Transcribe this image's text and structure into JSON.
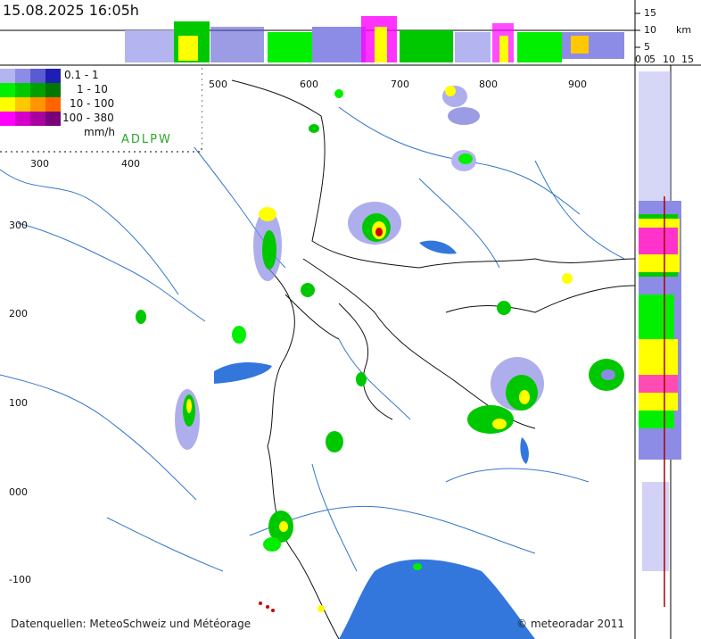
{
  "timestamp": "15.08.2025 16:05h",
  "sources": "Datenquellen: MeteoSchweiz und Météorage",
  "copyright": "© meteoradar 2011",
  "abbrev": "ADLPW",
  "legend": {
    "unit": "mm/h",
    "rows": [
      {
        "label": "0.1 -    1",
        "colors": [
          "#b4b4f0",
          "#8c8ce6",
          "#5a5ad2",
          "#1e1eb4"
        ]
      },
      {
        "label": "1 -   10",
        "colors": [
          "#00f000",
          "#00c800",
          "#00a000",
          "#007800"
        ]
      },
      {
        "label": "10 - 100",
        "colors": [
          "#ffff00",
          "#ffc800",
          "#ff9600",
          "#ff6400"
        ]
      },
      {
        "label": "100 - 380",
        "colors": [
          "#ff00ff",
          "#d200c8",
          "#aa00a0",
          "#780078"
        ]
      }
    ]
  },
  "axes": {
    "x_top": [
      "500",
      "600",
      "700",
      "800",
      "900"
    ],
    "x_left": [
      "300",
      "400"
    ],
    "y": [
      "300",
      "200",
      "100",
      "000",
      "-100"
    ],
    "height_scale": [
      "15",
      "10",
      "5",
      "0"
    ],
    "height_unit": "km",
    "side_scale": [
      "0",
      "5",
      "10",
      "15"
    ]
  }
}
